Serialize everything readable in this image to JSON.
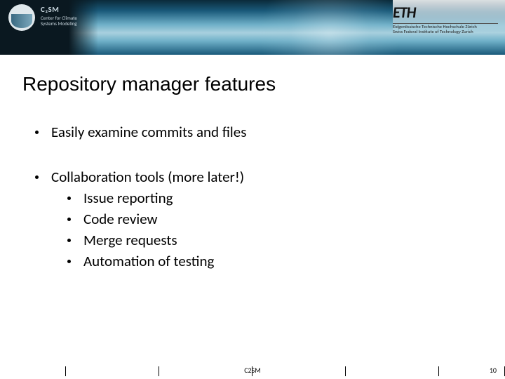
{
  "header": {
    "org_brand": "C₂SM",
    "org_line1": "Center for Climate",
    "org_line2": "Systems Modeling",
    "eth_logo": "ETH",
    "eth_line1": "Eidgenössische Technische Hochschule Zürich",
    "eth_line2": "Swiss Federal Institute of Technology Zurich"
  },
  "title": "Repository manager features",
  "bullets": {
    "b1": "Easily examine commits and files",
    "b2": "Collaboration tools (more later!)",
    "b2_1": "Issue reporting",
    "b2_2": "Code review",
    "b2_3": "Merge requests",
    "b2_4": "Automation of testing"
  },
  "footer": {
    "center": "C2SM",
    "page": "10"
  }
}
